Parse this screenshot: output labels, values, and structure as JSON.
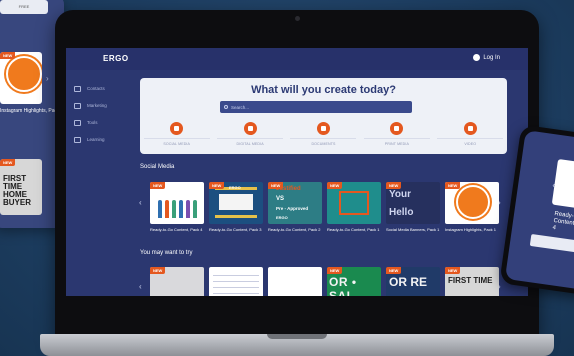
{
  "left_card": {
    "top_pill": "FREE",
    "caption": "Instagram Highlights, Pack 1",
    "thumb_text": "FIRST TIME HOME BUYER",
    "badge": "NEW"
  },
  "app": {
    "logo": "ERGO",
    "login": "Log In"
  },
  "sidebar": {
    "items": [
      {
        "label": "Contacts",
        "icon": "contacts-icon"
      },
      {
        "label": "Marketing",
        "icon": "megaphone-icon"
      },
      {
        "label": "Tools",
        "icon": "tools-icon"
      },
      {
        "label": "Learning",
        "icon": "book-icon"
      }
    ]
  },
  "hero": {
    "title": "What will you create today?",
    "search_placeholder": "Search...",
    "categories": [
      {
        "label": "SOCIAL MEDIA"
      },
      {
        "label": "DIGITAL MEDIA"
      },
      {
        "label": "DOCUMENTS"
      },
      {
        "label": "PRINT MEDIA"
      },
      {
        "label": "VIDEO"
      }
    ]
  },
  "sections": {
    "social_media": "Social Media",
    "you_may_want": "You may want to try"
  },
  "social_cards": [
    {
      "title": "Ready-to-Go Content, Pack 4",
      "badge": "NEW"
    },
    {
      "title": "Ready-to-Go Content, Pack 3",
      "badge": "NEW"
    },
    {
      "title": "Ready-to-Go Content, Pack 2",
      "badge": "NEW"
    },
    {
      "title": "Ready-to-Go Content, Pack 1",
      "badge": "NEW"
    },
    {
      "title": "Social Media Banners, Pack 1",
      "badge": "NEW"
    },
    {
      "title": "Instagram Highlights, Pack 1",
      "badge": "NEW"
    }
  ],
  "suggested_cards": [
    {
      "badge": "NEW"
    },
    {
      "badge": ""
    },
    {
      "badge": ""
    },
    {
      "badge": "NEW",
      "art_text": "OR • SAL"
    },
    {
      "badge": "NEW",
      "art_text": "OR RE"
    },
    {
      "badge": "NEW",
      "art_text": "FIRST TIME"
    }
  ],
  "art_text": {
    "ergo": "ERGO",
    "justified": "Justified",
    "vs": "VS",
    "pre_approved": "Pre - Approved",
    "hello": "Hello",
    "your": "Your"
  },
  "phone": {
    "caption": "Ready-to-Go Content, Pack 4"
  },
  "colors": {
    "accent": "#e4581f",
    "screen_bg": "#2b3770",
    "hero_bg": "#eef1f7"
  }
}
